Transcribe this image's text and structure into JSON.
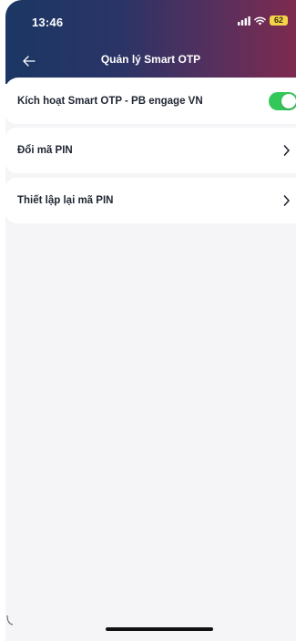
{
  "status_bar": {
    "time": "13:46",
    "battery": "62",
    "signal_icon": "signal-icon",
    "wifi_icon": "wifi-icon"
  },
  "header": {
    "title": "Quản lý Smart OTP",
    "back_icon": "arrow-left-icon",
    "gradient_colors": [
      "#1b3764",
      "#54305e",
      "#7e2a4f"
    ]
  },
  "menu": {
    "items": [
      {
        "label": "Kích hoạt Smart OTP - PB engage VN",
        "control": "toggle",
        "toggle_on": true
      },
      {
        "label": "Đổi mã PIN",
        "control": "chevron"
      },
      {
        "label": "Thiết lập lại mã PIN",
        "control": "chevron"
      }
    ]
  },
  "colors": {
    "toggle_on": "#34c759",
    "background": "#f5f5f7",
    "row_background": "#ffffff",
    "text": "#1f2532"
  }
}
